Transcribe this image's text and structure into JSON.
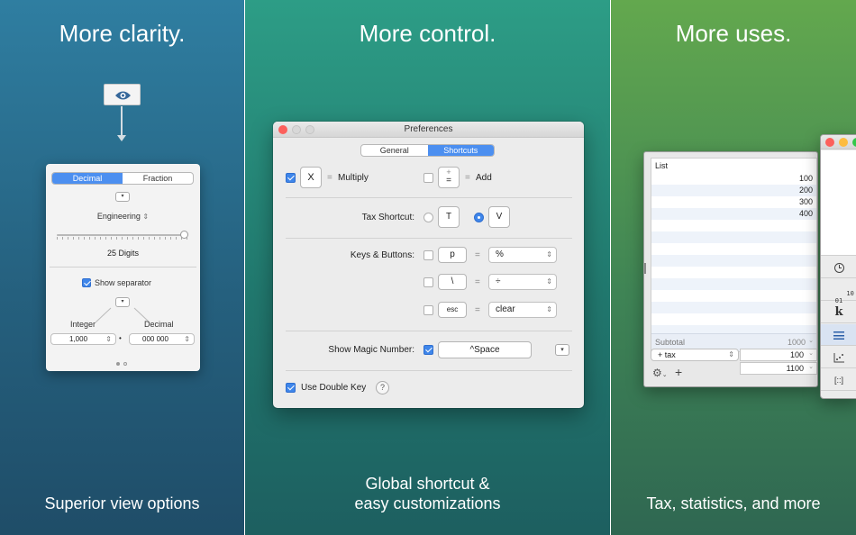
{
  "panels": {
    "clarity": {
      "headline": "More clarity.",
      "caption": "Superior view options"
    },
    "control": {
      "headline": "More control.",
      "caption_line1": "Global shortcut &",
      "caption_line2": "easy customizations"
    },
    "uses": {
      "headline": "More uses.",
      "caption": "Tax, statistics, and more"
    }
  },
  "view_popover": {
    "tabs": [
      "Decimal",
      "Fraction"
    ],
    "notation": "Engineering",
    "digits_label": "25 Digits",
    "digits_fraction": 1.0,
    "show_separator_label": "Show separator",
    "show_separator_checked": true,
    "integer_label": "Integer",
    "decimal_label": "Decimal",
    "integer_value": "1,000",
    "decimal_value": "000  000",
    "dot_separator": "•"
  },
  "preferences": {
    "title": "Preferences",
    "tabs": [
      "General",
      "Shortcuts"
    ],
    "multiply_key": "X",
    "multiply_label": "Multiply",
    "add_key_top": "+",
    "add_key_bottom": "=",
    "add_label": "Add",
    "equals_sign": "=",
    "tax_shortcut_label": "Tax Shortcut:",
    "tax_key_t": "T",
    "tax_key_v": "V",
    "keys_buttons_label": "Keys & Buttons:",
    "keys": [
      {
        "key": "p",
        "value": "%"
      },
      {
        "key": "\\",
        "value": "÷"
      },
      {
        "key": "esc",
        "value": "clear"
      }
    ],
    "magic_number_label": "Show Magic Number:",
    "magic_number_shortcut": "^Space",
    "use_double_key_label": "Use Double Key",
    "help_symbol": "?"
  },
  "calculator": {
    "list_header": "List",
    "values": [
      "100",
      "200",
      "300",
      "400"
    ],
    "subtotal_label": "Subtotal",
    "subtotal_value": "1000",
    "tax_label": "+ tax",
    "tax_value": "100",
    "total_value": "1100",
    "add_symbol": "+",
    "sidebar_glyphs": {
      "binary": "10\n01",
      "constant": "k",
      "bracket": "[::]"
    }
  },
  "colors": {
    "accent": "#3f86ea",
    "close": "#fc605c",
    "minimize": "#fdbc40",
    "zoom": "#34c84a"
  }
}
